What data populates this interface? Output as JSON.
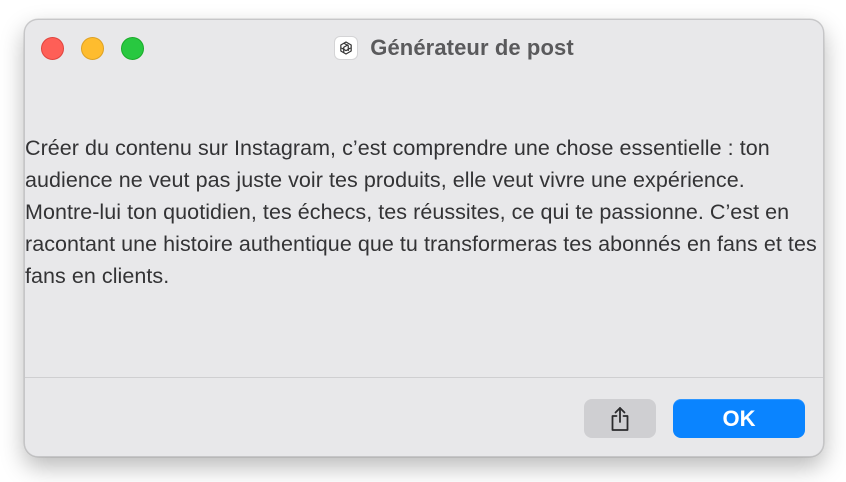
{
  "window": {
    "title": "Générateur de post",
    "app_icon": "openai-logo-icon"
  },
  "traffic_lights": {
    "close_color": "#fe5f57",
    "minimize_color": "#febc2e",
    "zoom_color": "#28c840"
  },
  "message": {
    "text": "Créer du contenu sur Instagram, c’est comprendre une chose essentielle : ton audience ne veut pas juste voir tes produits, elle veut vivre une expérience. Montre-lui ton quotidien, tes échecs, tes réussites, ce qui te passionne. C’est en racontant une histoire authentique que tu transformeras tes abonnés en fans et tes fans en clients."
  },
  "buttons": {
    "share_icon": "share-icon",
    "ok_label": "OK",
    "accent_color": "#0a84ff"
  }
}
